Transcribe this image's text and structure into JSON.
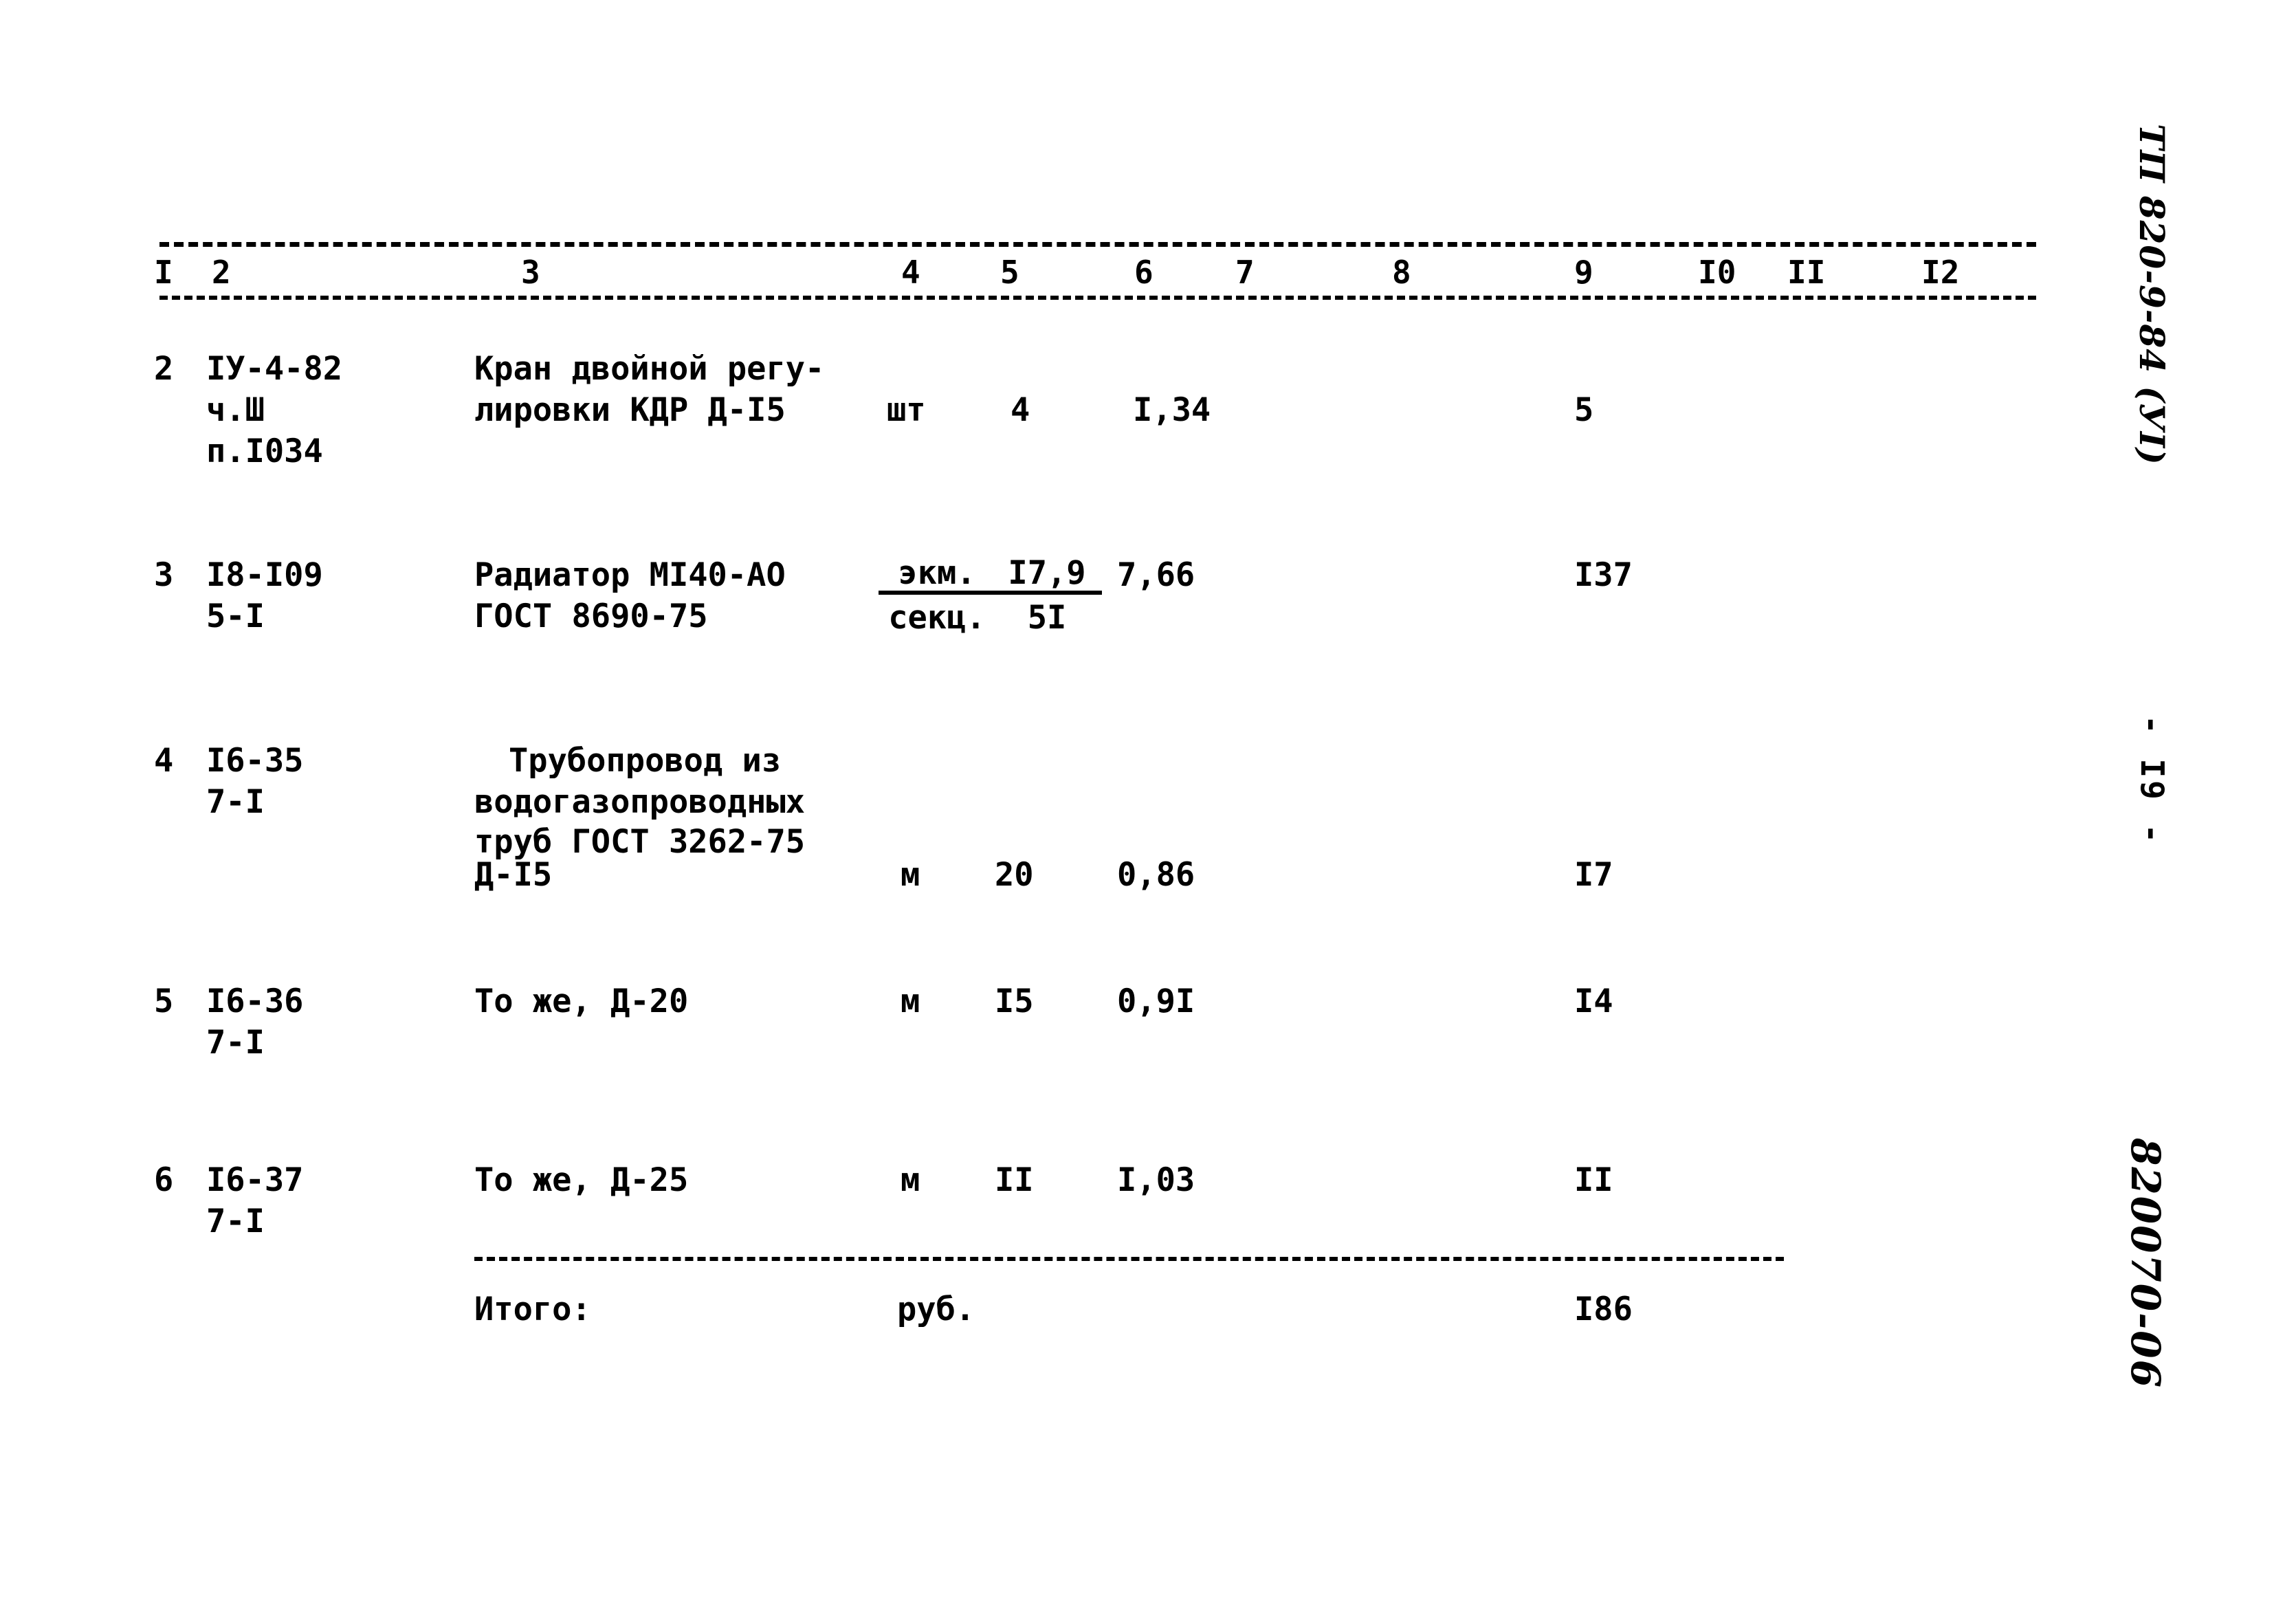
{
  "document": {
    "doc_code": "ТП 820-9-84 (УI)",
    "page_number": "- I9 -",
    "archive_code": "820070-06"
  },
  "table": {
    "column_headers": [
      "I",
      "2",
      "3",
      "4",
      "5",
      "6",
      "7",
      "8",
      "9",
      "I0",
      "II",
      "I2"
    ],
    "rows": [
      {
        "num": "2",
        "code_lines": [
          "IУ-4-82",
          "ч.Ш",
          "п.I034"
        ],
        "desc_lines": [
          "Кран двойной регу-",
          "лировки КДР Д-I5"
        ],
        "unit": "шт",
        "quantity": "4",
        "price": "I,34",
        "col7": "",
        "col8": "",
        "total": "5"
      },
      {
        "num": "3",
        "code_lines": [
          "I8-I09",
          "5-I"
        ],
        "desc_lines": [
          "Радиатор МI40-АО",
          "ГОСТ 8690-75"
        ],
        "unit_top": "экм.",
        "unit_bottom": "секц.",
        "quantity_top": "I7,9",
        "quantity_bottom": "5I",
        "price": "7,66",
        "col7": "",
        "col8": "",
        "total": "I37"
      },
      {
        "num": "4",
        "code_lines": [
          "I6-35",
          "7-I"
        ],
        "desc_lines": [
          "Трубопровод из",
          "водогазопроводных",
          "труб ГОСТ 3262-75",
          "Д-I5"
        ],
        "unit": "м",
        "quantity": "20",
        "price": "0,86",
        "col7": "",
        "col8": "",
        "total": "I7"
      },
      {
        "num": "5",
        "code_lines": [
          "I6-36",
          "7-I"
        ],
        "desc_lines": [
          "То же, Д-20"
        ],
        "unit": "м",
        "quantity": "I5",
        "price": "0,9I",
        "col7": "",
        "col8": "",
        "total": "I4"
      },
      {
        "num": "6",
        "code_lines": [
          "I6-37",
          "7-I"
        ],
        "desc_lines": [
          "То же, Д-25"
        ],
        "unit": "м",
        "quantity": "II",
        "price": "I,03",
        "col7": "",
        "col8": "",
        "total": "II"
      }
    ],
    "summary": {
      "label": "Итого:",
      "unit": "руб.",
      "total": "I86"
    }
  }
}
